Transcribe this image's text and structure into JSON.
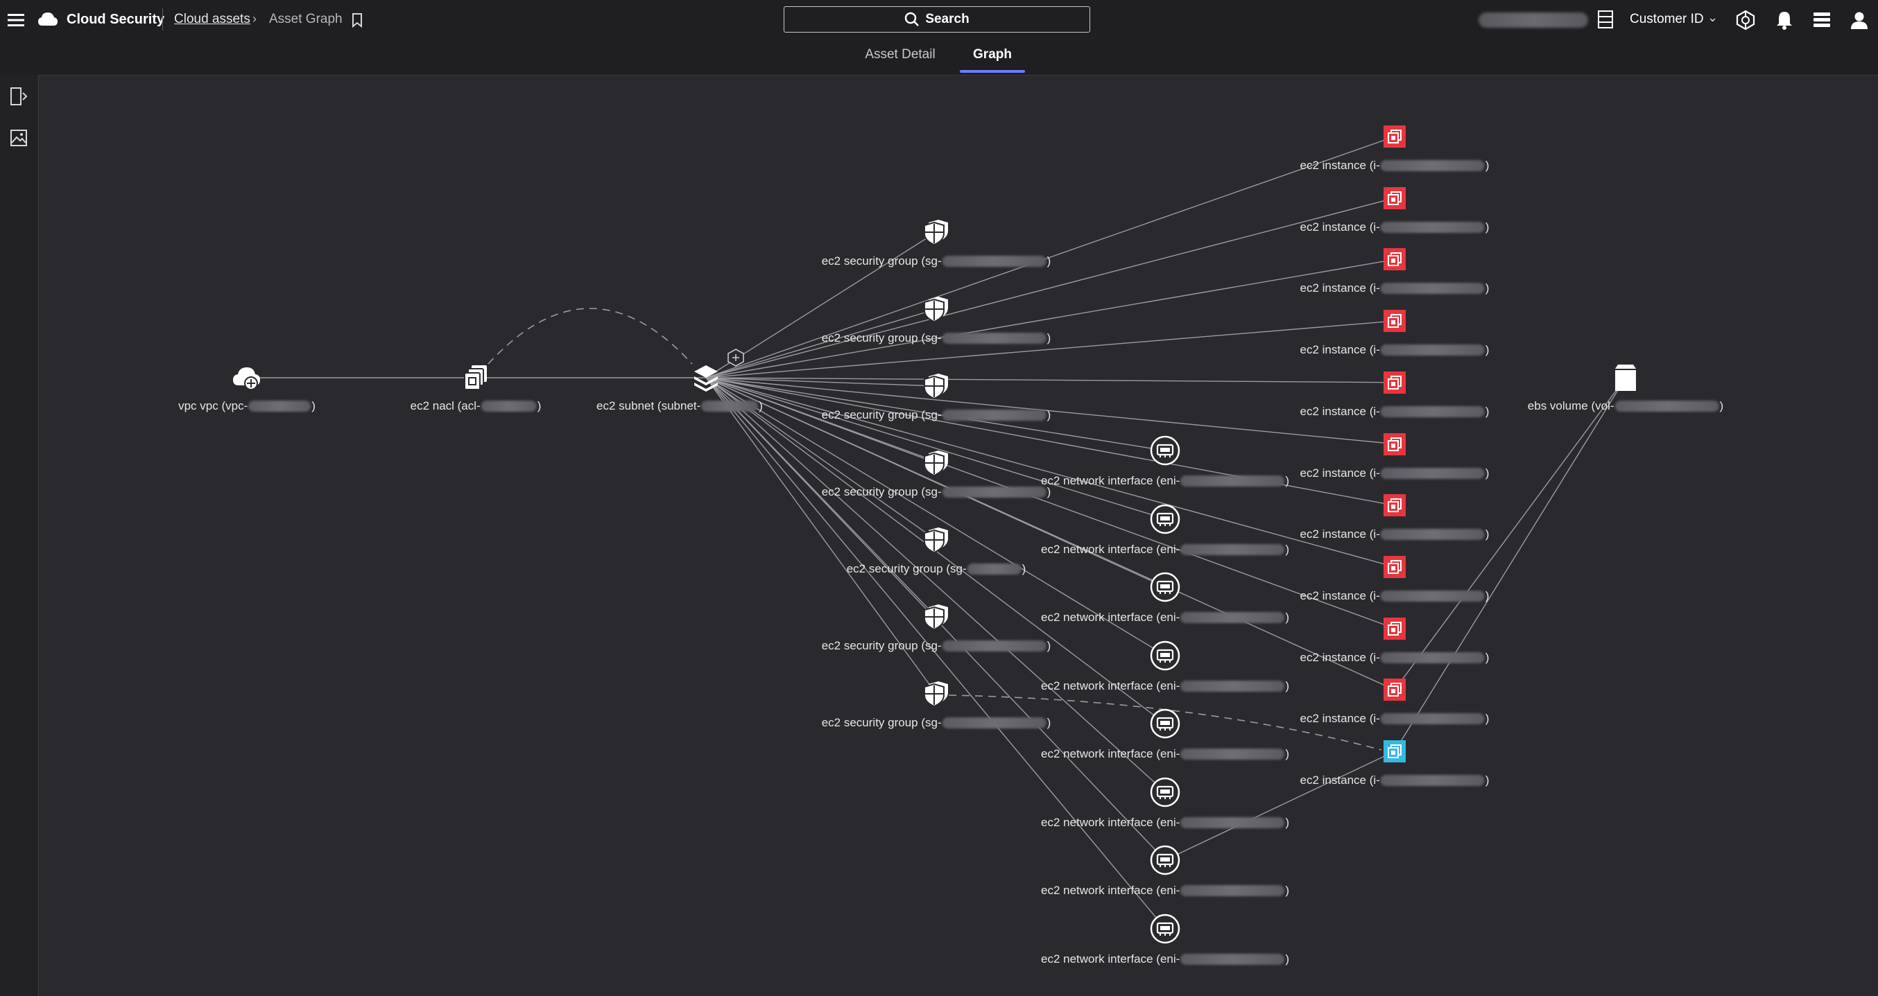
{
  "app": {
    "title": "Cloud Security",
    "breadcrumb": {
      "link": "Cloud assets",
      "current": "Asset Graph"
    }
  },
  "search": {
    "label": "Search"
  },
  "header": {
    "customer_label": "Customer ID"
  },
  "tabs": [
    {
      "label": "Asset Detail",
      "active": false
    },
    {
      "label": "Graph",
      "active": true
    }
  ],
  "colors": {
    "background": "#2a2a2e",
    "bar": "#1f1f22",
    "tab_accent": "#6d7cff",
    "alert_instance": "#e8363e",
    "selected_instance": "#35b9e0"
  },
  "graph": {
    "vpc": {
      "label": "vpc vpc (vpc-",
      "suffix": ")"
    },
    "nacl": {
      "label": "ec2 nacl (acl-",
      "suffix": ")"
    },
    "subnet": {
      "label": "ec2 subnet (subnet-",
      "suffix": ")"
    },
    "ebs": {
      "label": "ebs volume (vol-",
      "suffix": ")"
    },
    "security_groups": [
      {
        "label": "ec2 security group (sg-",
        "suffix": ")"
      },
      {
        "label": "ec2 security group (sg-",
        "suffix": ")"
      },
      {
        "label": "ec2 security group (sg-",
        "suffix": ")"
      },
      {
        "label": "ec2 security group (sg-",
        "suffix": ")"
      },
      {
        "label": "ec2 security group (sg-",
        "suffix": ")"
      },
      {
        "label": "ec2 security group (sg-",
        "suffix": ")"
      },
      {
        "label": "ec2 security group (sg-",
        "suffix": ")"
      }
    ],
    "network_interfaces": [
      {
        "label": "ec2 network interface (eni-",
        "suffix": ")"
      },
      {
        "label": "ec2 network interface (eni-",
        "suffix": ")"
      },
      {
        "label": "ec2 network interface (eni-",
        "suffix": ")"
      },
      {
        "label": "ec2 network interface (eni-",
        "suffix": ")"
      },
      {
        "label": "ec2 network interface (eni-",
        "suffix": ")"
      },
      {
        "label": "ec2 network interface (eni-",
        "suffix": ")"
      },
      {
        "label": "ec2 network interface (eni-",
        "suffix": ")"
      },
      {
        "label": "ec2 network interface (eni-",
        "suffix": ")"
      }
    ],
    "instances": [
      {
        "label": "ec2 instance (i-",
        "suffix": ")",
        "status": "alert"
      },
      {
        "label": "ec2 instance (i-",
        "suffix": ")",
        "status": "alert"
      },
      {
        "label": "ec2 instance (i-",
        "suffix": ")",
        "status": "alert"
      },
      {
        "label": "ec2 instance (i-",
        "suffix": ")",
        "status": "alert"
      },
      {
        "label": "ec2 instance (i-",
        "suffix": ")",
        "status": "alert"
      },
      {
        "label": "ec2 instance (i-",
        "suffix": ")",
        "status": "alert"
      },
      {
        "label": "ec2 instance (i-",
        "suffix": ")",
        "status": "alert"
      },
      {
        "label": "ec2 instance (i-",
        "suffix": ")",
        "status": "alert"
      },
      {
        "label": "ec2 instance (i-",
        "suffix": ")",
        "status": "alert"
      },
      {
        "label": "ec2 instance (i-",
        "suffix": ")",
        "status": "alert"
      },
      {
        "label": "ec2 instance (i-",
        "suffix": ")",
        "status": "selected"
      }
    ]
  }
}
